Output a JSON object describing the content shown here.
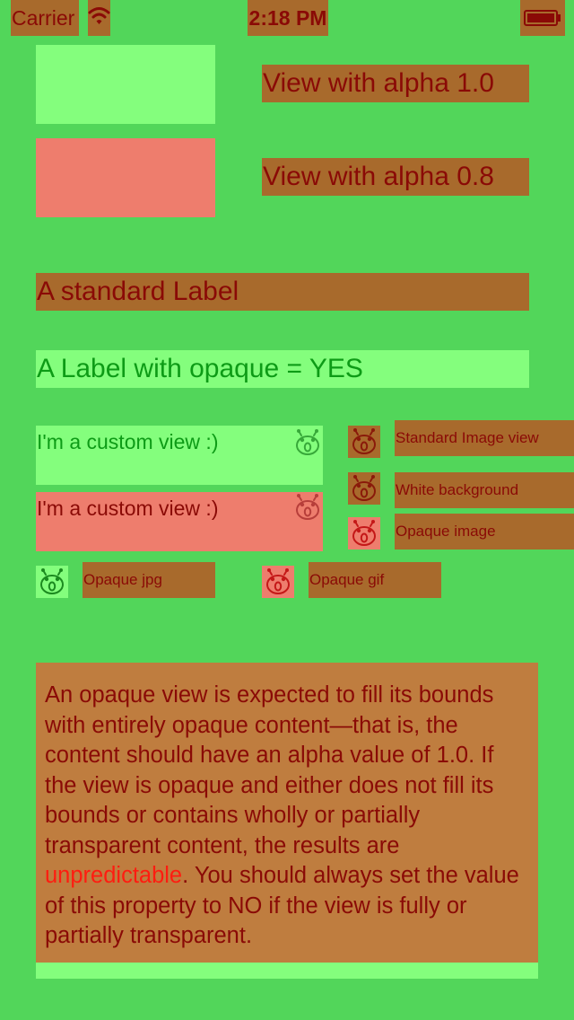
{
  "status_bar": {
    "carrier": "Carrier",
    "time": "2:18 PM",
    "wifi_icon": "wifi-icon",
    "battery_icon": "battery-icon"
  },
  "labels": {
    "alpha_1": "View with alpha 1.0",
    "alpha_08": "View with alpha 0.8",
    "standard": "A standard Label",
    "opaque": "A Label with opaque = YES",
    "custom_view_1": "I'm a custom view :)",
    "custom_view_2": "I'm a custom view :)",
    "standard_image": "Standard Image view",
    "white_background": "White background",
    "opaque_image": "Opaque image",
    "opaque_jpg": "Opaque jpg",
    "opaque_gif": "Opaque gif"
  },
  "paragraph": {
    "before": "An opaque view is expected to fill its bounds with entirely opaque content—that is, the content should have an alpha value of 1.0. If the view is opaque and either does not fill its bounds or contains wholly or partially transparent content, the results are ",
    "highlight": "unpredictable",
    "after": ". You should always set the value of this property to NO if the view is fully or partially transparent."
  },
  "icon_name": "robot-face-icon",
  "colors": {
    "background": "#52d65a",
    "blended": "#a86a2c",
    "opaque": "#84fe7d",
    "offscreen": "#ee7d6d",
    "text": "#8a0a06",
    "highlight": "#ff1c10"
  }
}
